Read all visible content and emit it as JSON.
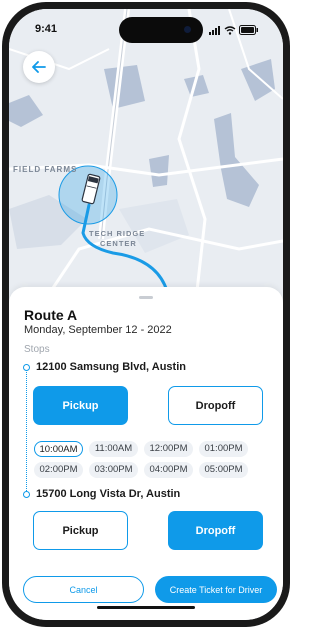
{
  "status_bar": {
    "time": "9:41"
  },
  "map": {
    "labels": {
      "field_farms": "FIELD FARMS",
      "tech_ridge_1": "TECH RIDGE",
      "tech_ridge_2": "CENTER"
    },
    "route_color": "#1a9be6"
  },
  "route": {
    "title": "Route A",
    "date": "Monday, September 12 - 2022",
    "stops_label": "Stops"
  },
  "stops": [
    {
      "address": "12100 Samsung Blvd, Austin",
      "pickup_label": "Pickup",
      "dropoff_label": "Dropoff",
      "selected": "pickup",
      "times": [
        [
          "10:00AM",
          "11:00AM",
          "12:00PM",
          "01:00PM"
        ],
        [
          "02:00PM",
          "03:00PM",
          "04:00PM",
          "05:00PM"
        ]
      ],
      "selected_time": "10:00AM"
    },
    {
      "address": "15700 Long Vista Dr, Austin",
      "pickup_label": "Pickup",
      "dropoff_label": "Dropoff",
      "selected": "dropoff"
    }
  ],
  "actions": {
    "cancel": "Cancel",
    "create_ticket": "Create Ticket for Driver"
  },
  "colors": {
    "accent": "#0f9ae9",
    "chip_bg": "#eef1f5"
  },
  "icons": {
    "back": "arrow-left-icon",
    "signal": "signal-icon",
    "wifi": "wifi-icon",
    "battery": "battery-icon",
    "truck": "truck-icon"
  }
}
